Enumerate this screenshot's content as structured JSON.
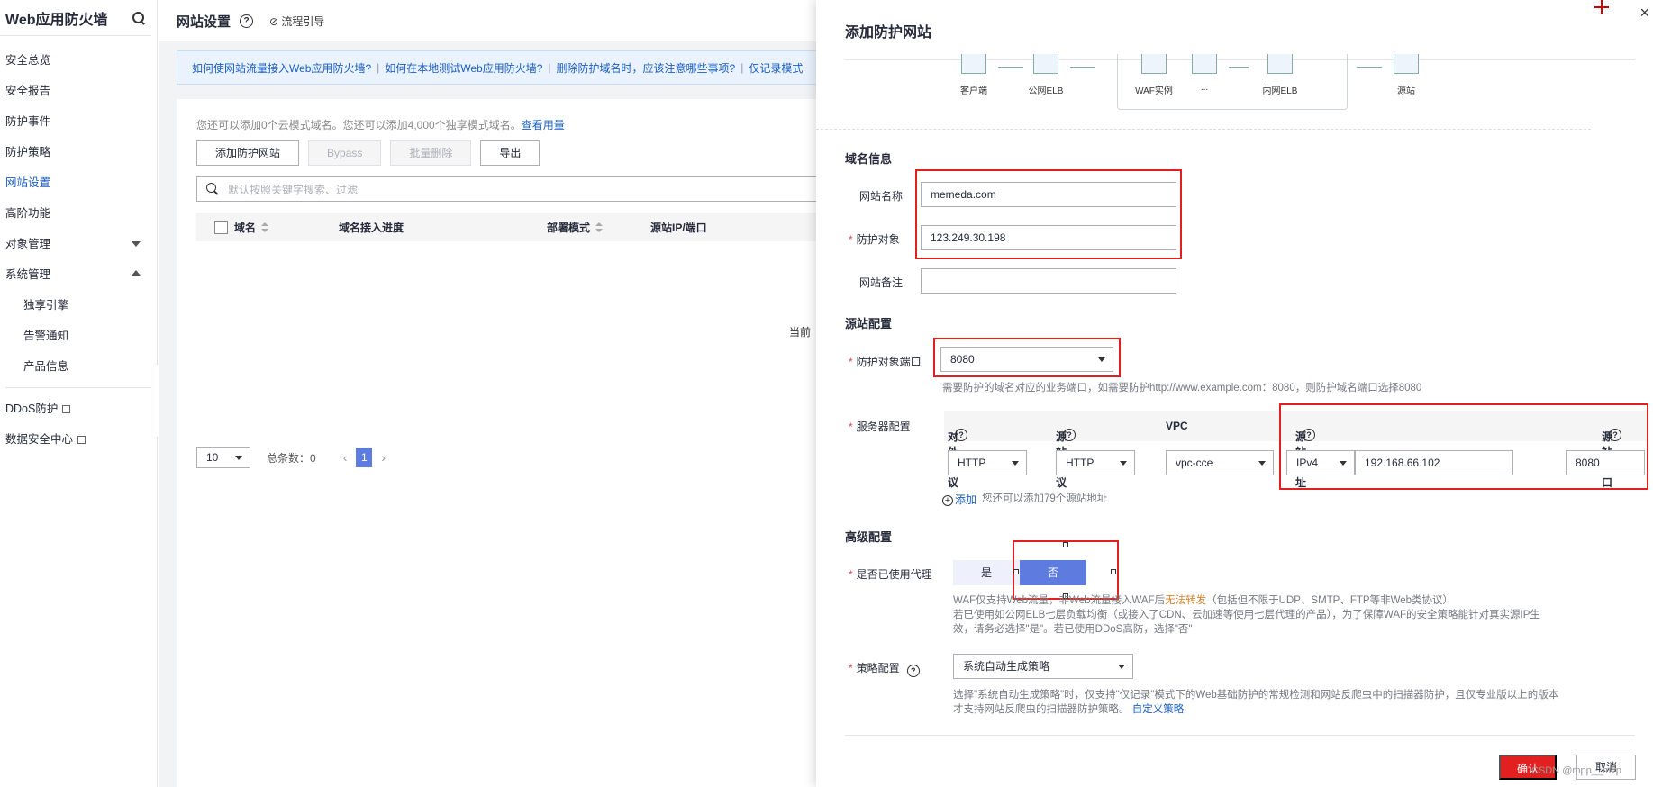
{
  "sidebar": {
    "title": "Web应用防火墙",
    "items": [
      {
        "label": "安全总览"
      },
      {
        "label": "安全报告"
      },
      {
        "label": "防护事件"
      },
      {
        "label": "防护策略"
      },
      {
        "label": "网站设置"
      },
      {
        "label": "高阶功能"
      },
      {
        "label": "对象管理"
      },
      {
        "label": "系统管理"
      },
      {
        "label": "独享引擎"
      },
      {
        "label": "告警通知"
      },
      {
        "label": "产品信息"
      }
    ],
    "links": [
      {
        "label": "DDoS防护"
      },
      {
        "label": "数据安全中心"
      }
    ]
  },
  "header": {
    "title": "网站设置",
    "help_icon": "?",
    "flow_guide": "流程引导"
  },
  "faq": {
    "items": [
      "如何使网站流量接入Web应用防火墙?",
      "如何在本地测试Web应用防火墙?",
      "删除防护域名时，应该注意哪些事项?",
      "仅记录模式"
    ]
  },
  "list": {
    "tip": "您还可以添加0个云模式域名。您还可以添加4,000个独享模式域名。",
    "tip_link": "查看用量",
    "buttons": {
      "add": "添加防护网站",
      "bypass": "Bypass",
      "batch_delete": "批量删除",
      "export": "导出"
    },
    "search_placeholder": "默认按照关键字搜索、过滤",
    "columns": [
      "域名",
      "域名接入进度",
      "部署模式",
      "源站IP/端口"
    ],
    "empty_text": "当前"
  },
  "pagination": {
    "page_size": "10",
    "total": "总条数：0",
    "current_page": "1"
  },
  "drawer": {
    "title": "添加防护网站",
    "close": "×",
    "topology": {
      "nodes": [
        "客户端",
        "公网ELB",
        "WAF实例",
        "...",
        "内网ELB",
        "源站"
      ]
    },
    "domain_section": {
      "title": "域名信息",
      "site_name_label": "网站名称",
      "site_name_value": "memeda.com",
      "target_label": "防护对象",
      "target_value": "123.249.30.198",
      "remark_label": "网站备注",
      "remark_value": ""
    },
    "origin_section": {
      "title": "源站配置",
      "port_label": "防护对象端口",
      "port_value": "8080",
      "port_hint": "需要防护的域名对应的业务端口，如需要防护http://www.example.com：8080，则防护域名端口选择8080",
      "server_label": "服务器配置",
      "server_headers": [
        "对外协议",
        "源站协议",
        "VPC",
        "源站地址",
        "源站端口"
      ],
      "server_row": {
        "client_protocol": "HTTP",
        "server_protocol": "HTTP",
        "vpc": "vpc-cce",
        "ip_type": "IPv4",
        "address": "192.168.66.102",
        "port": "8080"
      },
      "add_link": "添加",
      "add_hint": "您还可以添加79个源站地址"
    },
    "advanced_section": {
      "title": "高级配置",
      "proxy_label": "是否已使用代理",
      "proxy_yes": "是",
      "proxy_no": "否",
      "proxy_hint_1a": "WAF仅支持Web流量，非Web流量接入WAF后",
      "proxy_hint_1b": "无法转发",
      "proxy_hint_1c": "（包括但不限于UDP、SMTP、FTP等非Web类协议）",
      "proxy_hint_2": "若已使用如公网ELB七层负载均衡（或接入了CDN、云加速等使用七层代理的产品），为了保障WAF的安全策略能针对真实源IP生",
      "proxy_hint_3": "效，请务必选择\"是\"。若已使用DDoS高防，选择\"否\"",
      "policy_label": "策略配置",
      "policy_value": "系统自动生成策略",
      "policy_hint_1": "选择\"系统自动生成策略\"时，仅支持\"仅记录\"模式下的Web基础防护的常规检测和网站反爬虫中的扫描器防护，且仅专业版以上的版本",
      "policy_hint_2": "才支持网站反爬虫的扫描器防护策略。",
      "policy_link": "自定义策略"
    },
    "footer": {
      "confirm": "确认",
      "cancel": "取消",
      "watermark": "CSDN @mpp__mvp"
    }
  },
  "colors": {
    "accent": "#5e7ce0",
    "link": "#1a5fc4",
    "highlight": "#e32020"
  }
}
